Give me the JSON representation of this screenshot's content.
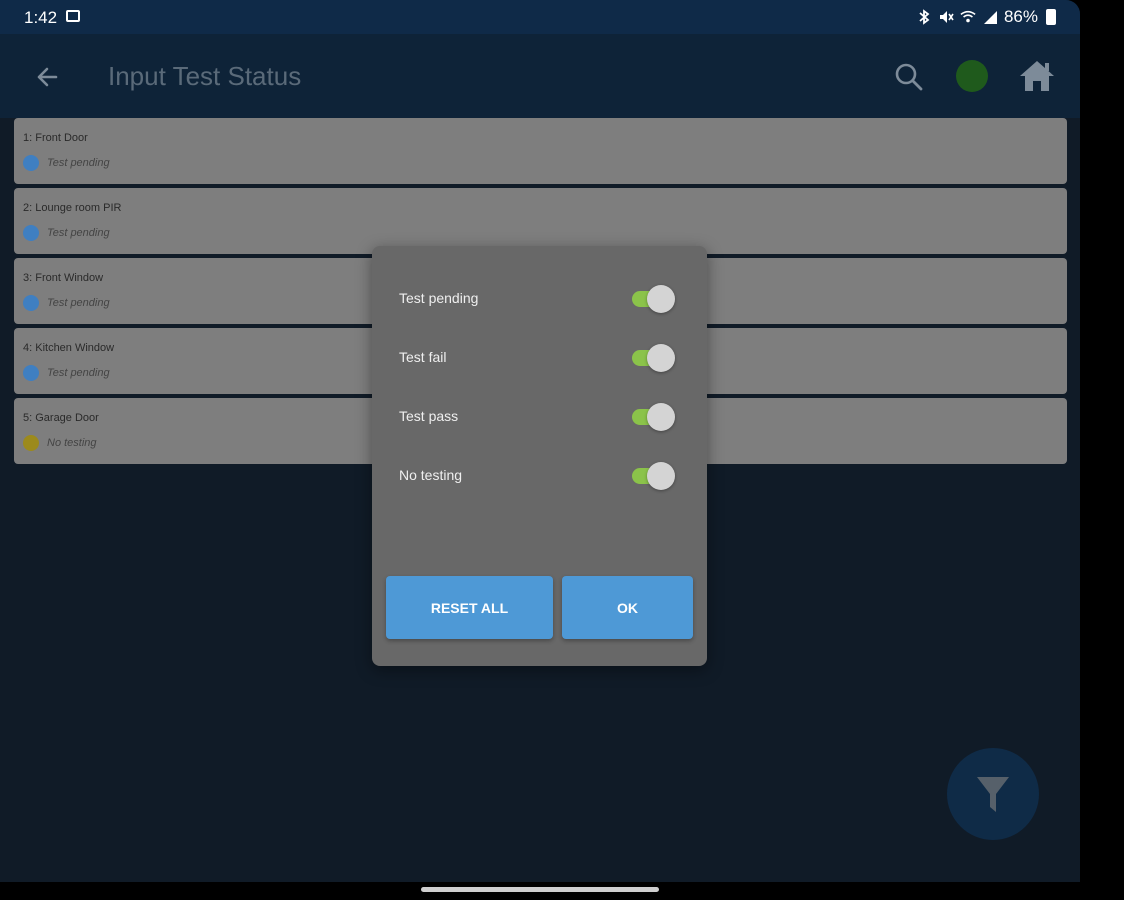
{
  "status_bar": {
    "time": "1:42",
    "battery": "86%",
    "icons": [
      "image-icon",
      "bluetooth-icon",
      "mute-icon",
      "wifi-icon",
      "signal-icon",
      "battery-icon"
    ]
  },
  "app_bar": {
    "title": "Input Test Status",
    "icons": [
      "back-arrow-icon",
      "search-icon",
      "status-dot",
      "home-icon"
    ],
    "status_dot_color": "#1f5a1c"
  },
  "inputs": [
    {
      "name": "1: Front Door",
      "status": "Test pending",
      "color": "#3f7fc1"
    },
    {
      "name": "2: Lounge room PIR",
      "status": "Test pending",
      "color": "#3f7fc1"
    },
    {
      "name": "3: Front Window",
      "status": "Test pending",
      "color": "#3f7fc1"
    },
    {
      "name": "4: Kitchen Window",
      "status": "Test pending",
      "color": "#3f7fc1"
    },
    {
      "name": "5: Garage Door",
      "status": "No testing",
      "color": "#9c8a1c"
    }
  ],
  "filter_dialog": {
    "options": [
      {
        "label": "Test pending",
        "enabled": true
      },
      {
        "label": "Test fail",
        "enabled": true
      },
      {
        "label": "Test pass",
        "enabled": true
      },
      {
        "label": "No testing",
        "enabled": true
      }
    ],
    "reset_label": "RESET ALL",
    "ok_label": "OK",
    "toggle_on_color": "#8bc34a",
    "button_color": "#4e99d6"
  },
  "fab": {
    "icon": "filter-icon"
  }
}
